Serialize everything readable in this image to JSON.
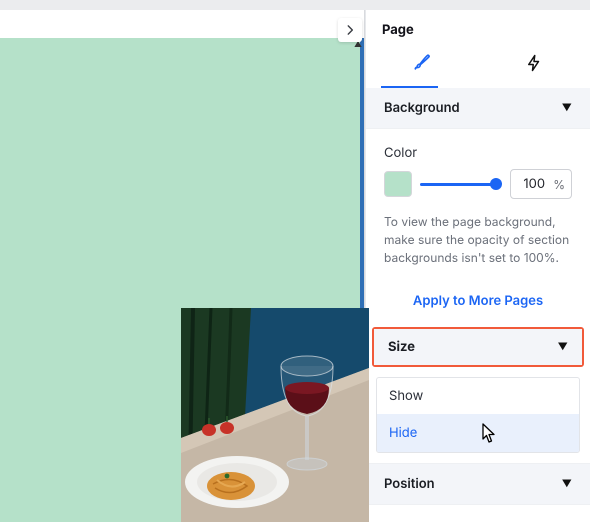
{
  "panel": {
    "title": "Page",
    "tabs": {
      "active": "design",
      "icons": [
        "brush",
        "lightning"
      ]
    },
    "sections": {
      "background": {
        "label": "Background",
        "color": {
          "label": "Color",
          "hex": "#b5e1c9",
          "opacity": 100,
          "unit": "%"
        },
        "hint": "To view the page background, make sure the opacity of section backgrounds isn't set to 100%.",
        "apply_link": "Apply to More Pages"
      },
      "size": {
        "label": "Size",
        "options": [
          {
            "label": "Show",
            "selected": false
          },
          {
            "label": "Hide",
            "selected": true
          }
        ]
      },
      "position": {
        "label": "Position"
      }
    }
  }
}
